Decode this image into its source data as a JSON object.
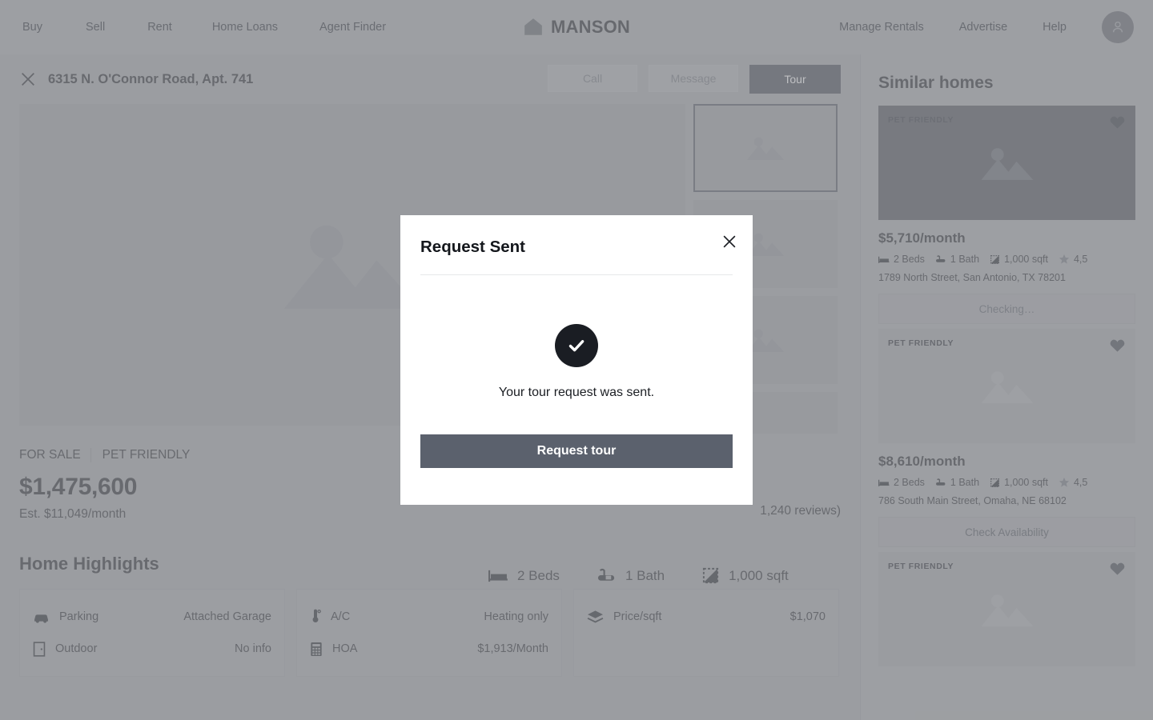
{
  "nav": {
    "left_links": [
      "Buy",
      "Sell",
      "Rent",
      "Home Loans",
      "Agent Finder"
    ],
    "brand": "MANSON",
    "right_links": [
      "Manage Rentals",
      "Advertise",
      "Help"
    ],
    "avatar_icon": "user-avatar-icon"
  },
  "listing_header": {
    "close_icon": "close-icon",
    "address": "6315 N. O'Connor Road, Apt. 741",
    "actions": [
      {
        "label": "Call",
        "style": "ghost"
      },
      {
        "label": "Message",
        "style": "ghost"
      },
      {
        "label": "Tour",
        "style": "primary"
      }
    ]
  },
  "gallery": {
    "placeholder_icon": "image-placeholder-icon",
    "thumb_count": 4,
    "selected_index": 0
  },
  "listing": {
    "tags": [
      "FOR SALE",
      "PET FRIENDLY"
    ],
    "price": "$1,475,600",
    "est_monthly": "Est. $11,049/month",
    "reviews": "1,240 reviews)",
    "stats": [
      {
        "icon": "bed-icon",
        "label": "2 Beds"
      },
      {
        "icon": "bath-icon",
        "label": "1 Bath"
      },
      {
        "icon": "area-icon",
        "label": "1,000 sqft"
      }
    ]
  },
  "highlights": {
    "title": "Home Highlights",
    "cards": [
      [
        {
          "icon": "car-icon",
          "label": "Parking",
          "value": "Attached Garage"
        },
        {
          "icon": "door-icon",
          "label": "Outdoor",
          "value": "No info"
        }
      ],
      [
        {
          "icon": "thermometer-icon",
          "label": "A/C",
          "value": "Heating only"
        },
        {
          "icon": "calculator-icon",
          "label": "HOA",
          "value": "$1,913/Month"
        }
      ],
      [
        {
          "icon": "layers-icon",
          "label": "Price/sqft",
          "value": "$1,070"
        }
      ]
    ]
  },
  "sidebar": {
    "title": "Similar homes",
    "cards": [
      {
        "badge": "PET FRIENDLY",
        "heart_icon": "heart-icon",
        "price": "$5,710/month",
        "specs": [
          {
            "icon": "bed-icon",
            "label": "2 Beds"
          },
          {
            "icon": "bath-icon",
            "label": "1 Bath"
          },
          {
            "icon": "area-icon",
            "label": "1,000 sqft"
          },
          {
            "icon": "star-icon",
            "label": "4,5"
          }
        ],
        "address": "1789 North Street, San Antonio, TX 78201",
        "button": "Checking…",
        "image_tone": "dark"
      },
      {
        "badge": "PET FRIENDLY",
        "heart_icon": "heart-icon",
        "price": "$8,610/month",
        "specs": [
          {
            "icon": "bed-icon",
            "label": "2 Beds"
          },
          {
            "icon": "bath-icon",
            "label": "1 Bath"
          },
          {
            "icon": "area-icon",
            "label": "1,000 sqft"
          },
          {
            "icon": "star-icon",
            "label": "4,5"
          }
        ],
        "address": "786 South Main Street, Omaha, NE 68102",
        "button": "Check Availability",
        "image_tone": "light"
      },
      {
        "badge": "PET FRIENDLY",
        "heart_icon": "heart-icon",
        "image_tone": "light"
      }
    ]
  },
  "modal": {
    "title": "Request Sent",
    "close_icon": "close-icon",
    "success_icon": "check-circle-icon",
    "message": "Your tour request was sent.",
    "cta": "Request tour"
  },
  "colors": {
    "page_bg": "#a3a5a8",
    "nav_bg": "#a8aaad",
    "accent_dark": "#3f4550",
    "cta": "#5b616d",
    "success": "#1a1d23"
  }
}
